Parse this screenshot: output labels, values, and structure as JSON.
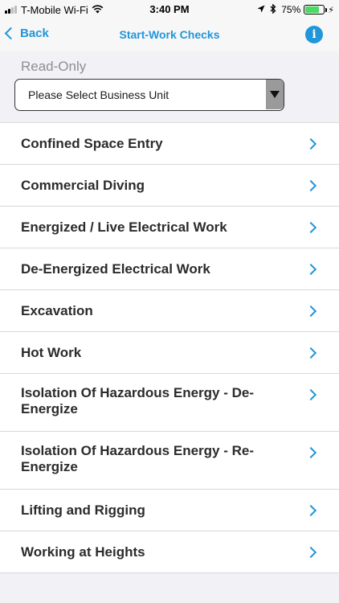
{
  "status_bar": {
    "carrier": "T-Mobile Wi-Fi",
    "time": "3:40 PM",
    "battery_percent": "75%",
    "battery_level": 0.75,
    "icons": [
      "signal-icon",
      "wifi-icon",
      "location-icon",
      "bluetooth-icon",
      "battery-icon",
      "charging-icon"
    ]
  },
  "nav": {
    "back_label": "Back",
    "title": "Start-Work Checks",
    "info_glyph": "i"
  },
  "filter": {
    "label": "Read-Only",
    "business_unit_placeholder": "Please Select Business Unit"
  },
  "accent_color": "#2196d9",
  "items": [
    {
      "label": "Confined Space Entry"
    },
    {
      "label": "Commercial Diving"
    },
    {
      "label": "Energized / Live Electrical Work"
    },
    {
      "label": "De-Energized Electrical Work"
    },
    {
      "label": "Excavation"
    },
    {
      "label": "Hot Work"
    },
    {
      "label": "Isolation Of Hazardous Energy - De-Energize"
    },
    {
      "label": "Isolation Of Hazardous Energy - Re-Energize"
    },
    {
      "label": "Lifting and Rigging"
    },
    {
      "label": "Working at Heights"
    }
  ]
}
